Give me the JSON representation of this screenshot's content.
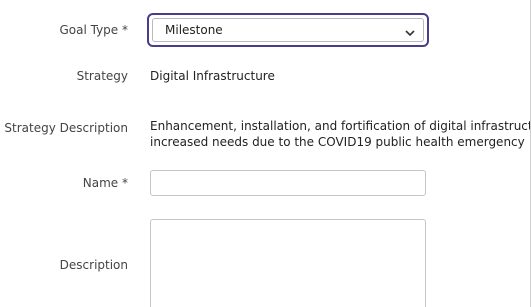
{
  "form": {
    "goal_type": {
      "label": "Goal Type *",
      "selected": "Milestone"
    },
    "strategy": {
      "label": "Strategy",
      "value": "Digital Infrastructure"
    },
    "strategy_description": {
      "label": "Strategy Description",
      "line1": "Enhancement, installation, and fortification of digital infrastructure",
      "line2": "increased needs due to the COVID19 public health emergency"
    },
    "name": {
      "label": "Name *",
      "value": ""
    },
    "description": {
      "label": "Description",
      "value": ""
    }
  },
  "colors": {
    "focus_border": "#4a3c8c",
    "input_border": "#c5c5c5"
  }
}
